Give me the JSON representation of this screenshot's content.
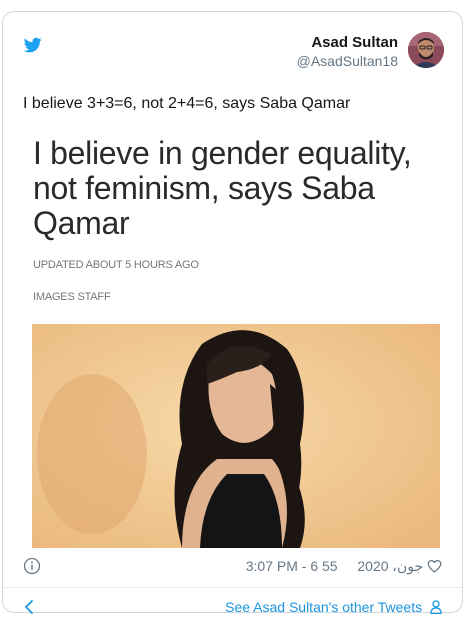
{
  "author": {
    "name": "Asad Sultan",
    "handle": "@AsadSultan18"
  },
  "tweet": {
    "text": "I believe 3+3=6, not 2+4=6, says Saba Qamar"
  },
  "article": {
    "headline": "I believe in gender equality, not feminism, says Saba Qamar",
    "updated": "UPDATED ABOUT 5 HOURS AGO",
    "byline": "IMAGES STAFF"
  },
  "footer": {
    "likes": "55",
    "timestamp": "3:07 PM - 6 جون، 2020",
    "see_more": "See Asad Sultan's other Tweets"
  },
  "icons": {
    "brand": "twitter-bird-icon",
    "info": "info-icon",
    "like": "heart-icon",
    "back": "chevron-left-icon",
    "profile": "person-icon"
  },
  "colors": {
    "twitter_blue": "#1da1f2",
    "link_blue": "#1b95e0",
    "muted": "#657786",
    "border": "#cfd9de"
  }
}
